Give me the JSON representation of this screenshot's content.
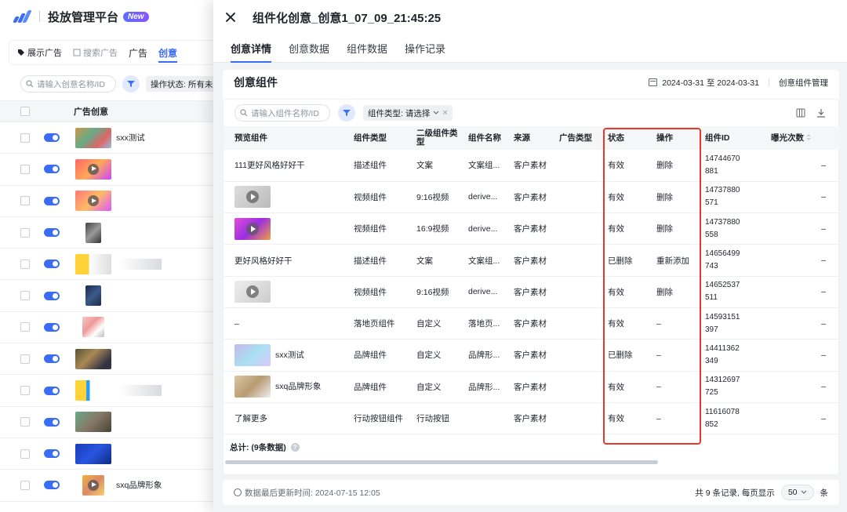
{
  "app": {
    "title": "投放管理平台",
    "badge": "New"
  },
  "bg_tabs": {
    "display_ads": "展示广告",
    "search_ads": "搜索广告",
    "ad": "广告",
    "creative": "创意"
  },
  "bg_filter": {
    "search_placeholder": "请输入创意名称/ID",
    "status_chip": "操作状态: 所有未删"
  },
  "bg_table": {
    "header": "广告创意",
    "rows": [
      {
        "name": "sxx测试"
      },
      {
        "name": ""
      },
      {
        "name": ""
      },
      {
        "name": ""
      },
      {
        "name": ""
      },
      {
        "name": ""
      },
      {
        "name": ""
      },
      {
        "name": ""
      },
      {
        "name": ""
      },
      {
        "name": ""
      },
      {
        "name": ""
      },
      {
        "name": "sxq品牌形象"
      }
    ]
  },
  "drawer": {
    "title": "组件化创意_创意1_07_09_21:45:25",
    "tabs": [
      "创意详情",
      "创意数据",
      "组件数据",
      "操作记录"
    ]
  },
  "panel": {
    "title": "创意组件",
    "date_range": "2024-03-31 至 2024-03-31",
    "manage_link": "创意组件管理",
    "search_placeholder": "请输入组件名称/ID",
    "type_chip": "组件类型: 请选择",
    "columns": [
      "预览组件",
      "组件类型",
      "二级组件类型",
      "组件名称",
      "来源",
      "广告类型",
      "状态",
      "操作",
      "组件ID",
      "曝光次数"
    ],
    "rows": [
      {
        "preview": "111更好风格好好干",
        "type": "描述组件",
        "subtype": "文案",
        "name": "文案组...",
        "source": "客户素材",
        "ad_type": "",
        "status": "有效",
        "action": "删除",
        "id_a": "14744670",
        "id_b": "881",
        "impr": "–"
      },
      {
        "preview": "",
        "type": "视频组件",
        "subtype": "9:16视频",
        "name": "derive...",
        "source": "客户素材",
        "ad_type": "",
        "status": "有效",
        "action": "删除",
        "id_a": "14737880",
        "id_b": "571",
        "impr": "–"
      },
      {
        "preview": "",
        "type": "视频组件",
        "subtype": "16:9视频",
        "name": "derive...",
        "source": "客户素材",
        "ad_type": "",
        "status": "有效",
        "action": "删除",
        "id_a": "14737880",
        "id_b": "558",
        "impr": "–"
      },
      {
        "preview": "更好风格好好干",
        "type": "描述组件",
        "subtype": "文案",
        "name": "文案组...",
        "source": "客户素材",
        "ad_type": "",
        "status": "已删除",
        "action": "重新添加",
        "id_a": "14656499",
        "id_b": "743",
        "impr": "–"
      },
      {
        "preview": "",
        "type": "视频组件",
        "subtype": "9:16视频",
        "name": "derive...",
        "source": "客户素材",
        "ad_type": "",
        "status": "有效",
        "action": "删除",
        "id_a": "14652537",
        "id_b": "511",
        "impr": "–"
      },
      {
        "preview": "–",
        "type": "落地页组件",
        "subtype": "自定义",
        "name": "落地页...",
        "source": "客户素材",
        "ad_type": "",
        "status": "有效",
        "action": "–",
        "id_a": "14593151",
        "id_b": "397",
        "impr": "–"
      },
      {
        "preview": "sxx测试",
        "type": "品牌组件",
        "subtype": "自定义",
        "name": "品牌形...",
        "source": "客户素材",
        "ad_type": "",
        "status": "已删除",
        "action": "–",
        "id_a": "14411362",
        "id_b": "349",
        "impr": "–"
      },
      {
        "preview": "sxq品牌形象",
        "type": "品牌组件",
        "subtype": "自定义",
        "name": "品牌形...",
        "source": "客户素材",
        "ad_type": "",
        "status": "有效",
        "action": "–",
        "id_a": "14312697",
        "id_b": "725",
        "impr": "–"
      },
      {
        "preview": "了解更多",
        "type": "行动按钮组件",
        "subtype": "行动按钮",
        "name": "",
        "source": "客户素材",
        "ad_type": "",
        "status": "有效",
        "action": "–",
        "id_a": "11616078",
        "id_b": "852",
        "impr": "–"
      }
    ],
    "total": "总计: (9条数据)"
  },
  "bottom": {
    "last_update": "数据最后更新时间: 2024-07-15 12:05",
    "total_records": "共 9 条记录, 每页显示",
    "page_size": "50",
    "unit": "条"
  },
  "colors": {
    "accent": "#3a6cf4",
    "highlight": "#e8372b"
  }
}
